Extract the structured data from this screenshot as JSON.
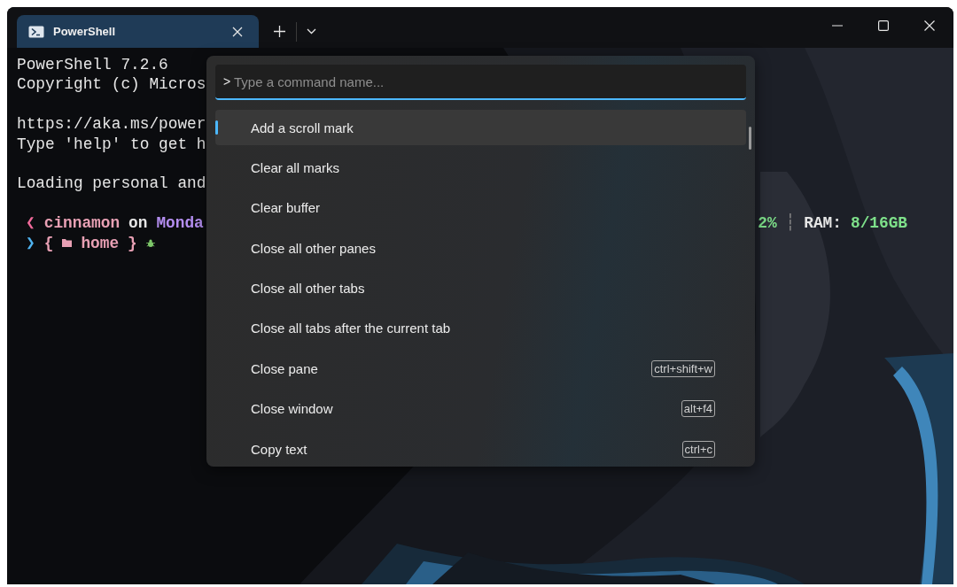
{
  "window": {
    "tabs": [
      {
        "title": "PowerShell",
        "selected": true
      }
    ]
  },
  "terminal": {
    "blocks": [
      [
        "PowerShell 7.2.6",
        "Copyright (c) Micros"
      ],
      [
        "https://aka.ms/power",
        "Type 'help' to get h"
      ],
      [
        "Loading personal and"
      ]
    ],
    "prompt": [
      {
        "left": [
          {
            "text": "❮",
            "color": "#f06a9a"
          },
          {
            "text": "cinnamon",
            "color": "#e8a0b4"
          },
          {
            "text": "on",
            "color": "#e6e6e6"
          },
          {
            "text": "Monda",
            "color": "#b48ef0"
          }
        ],
        "right": [
          {
            "text": "2%",
            "color": "#7ee08a"
          },
          {
            "text": "┆",
            "color": "#8a8a8a"
          },
          {
            "text": "RAM:",
            "color": "#e6e6e6"
          },
          {
            "text": "8/16GB",
            "color": "#7ee08a"
          }
        ]
      },
      {
        "left": [
          {
            "text": "❯",
            "color": "#4fb3f0"
          },
          {
            "text": "{",
            "color": "#e8a0b4"
          },
          {
            "kind": "folder",
            "color": "#e8a0b4"
          },
          {
            "text": "home",
            "color": "#e8a0b4"
          },
          {
            "text": "}",
            "color": "#e8a0b4"
          },
          {
            "kind": "bug",
            "color": "#7ec86a"
          }
        ]
      }
    ]
  },
  "command_palette": {
    "prefix": ">",
    "placeholder": "Type a command name...",
    "commands": [
      {
        "label": "Add a scroll mark",
        "selected": true
      },
      {
        "label": "Clear all marks",
        "selected": false
      },
      {
        "label": "Clear buffer",
        "selected": false
      },
      {
        "label": "Close all other panes",
        "selected": false
      },
      {
        "label": "Close all other tabs",
        "selected": false
      },
      {
        "label": "Close all tabs after the current tab",
        "selected": false
      },
      {
        "label": "Close pane",
        "shortcut": "ctrl+shift+w",
        "selected": false
      },
      {
        "label": "Close window",
        "shortcut": "alt+f4",
        "selected": false
      },
      {
        "label": "Copy text",
        "shortcut": "ctrl+c",
        "selected": false
      }
    ]
  }
}
